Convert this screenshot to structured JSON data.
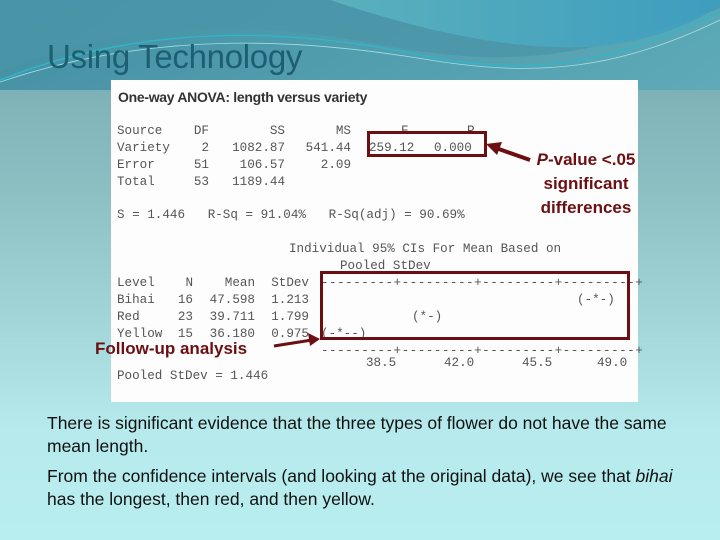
{
  "slide": {
    "title": "Using Technology"
  },
  "output": {
    "heading": "One-way ANOVA: length versus variety",
    "anova_table": {
      "header": [
        "Source",
        "DF",
        "SS",
        "MS",
        "F",
        "P"
      ],
      "rows": [
        [
          "Variety",
          "2",
          "1082.87",
          "541.44",
          "259.12",
          "0.000"
        ],
        [
          "Error",
          "51",
          "106.57",
          "2.09",
          "",
          ""
        ],
        [
          "Total",
          "53",
          "1189.44",
          "",
          "",
          ""
        ]
      ]
    },
    "summary_line": "S = 1.446   R-Sq = 91.04%   R-Sq(adj) = 90.69%",
    "ci_heading_1": "Individual 95% CIs For Mean Based on",
    "ci_heading_2": "Pooled StDev",
    "level_table": {
      "header": [
        "Level",
        "N",
        "Mean",
        "StDev"
      ],
      "rows": [
        [
          "Bihai",
          "16",
          "47.598",
          "1.213"
        ],
        [
          "Red",
          "23",
          "39.711",
          "1.799"
        ],
        [
          "Yellow",
          "15",
          "36.180",
          "0.975"
        ]
      ]
    },
    "ci_plot": {
      "top_axis": "---------+---------+---------+---------+",
      "bottom_axis": "---------+---------+---------+---------+",
      "intervals": [
        "(-*-)",
        "(*-)",
        "(-*--)"
      ],
      "tick_labels": [
        "38.5",
        "42.0",
        "45.5",
        "49.0"
      ]
    },
    "pooled_line": "Pooled StDev = 1.446"
  },
  "annotations": {
    "pvalue_line1_italic": "P",
    "pvalue_line1_rest": "-value <.05",
    "pvalue_line2": "significant",
    "pvalue_line3": "differences",
    "followup": "Follow-up analysis",
    "color": "#6b0f12"
  },
  "body": {
    "para1": "There is significant evidence that the three types of flower do not have the same mean length.",
    "para2_pre": "From the confidence intervals (and looking at the original data), we see that ",
    "para2_italic": "bihai",
    "para2_post": " has the longest, then red, and then yellow."
  }
}
